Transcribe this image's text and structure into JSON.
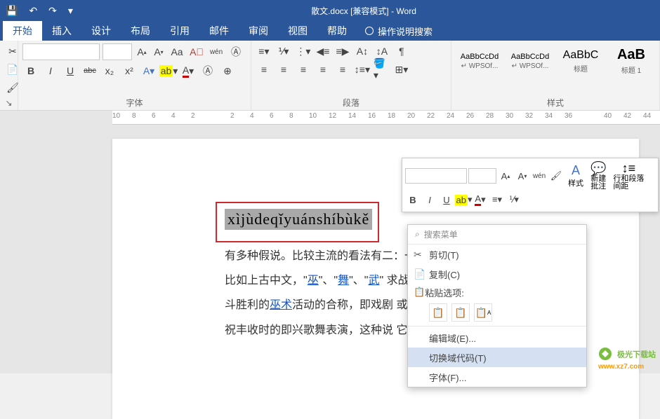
{
  "title": "散文.docx [兼容模式] - Word",
  "tabs": {
    "t0": "开始",
    "t1": "插入",
    "t2": "设计",
    "t3": "布局",
    "t4": "引用",
    "t5": "邮件",
    "t6": "审阅",
    "t7": "视图",
    "t8": "帮助"
  },
  "tellme": "操作说明搜索",
  "font": {
    "bold": "B",
    "italic": "I",
    "underline": "U",
    "strike": "abc",
    "sub": "x₂",
    "sup": "x²",
    "grow": "A",
    "shrink": "A",
    "case": "Aa",
    "clear": "A",
    "wen": "wén",
    "ruby": "A",
    "color": "A",
    "hilite": "ab"
  },
  "group_labels": {
    "font": "字体",
    "para": "段落",
    "style": "样式"
  },
  "styles": [
    {
      "preview": "AaBbCcDd",
      "name": "↵ WPSOf..."
    },
    {
      "preview": "AaBbCcDd",
      "name": "↵ WPSOf..."
    },
    {
      "preview": "AaBbC",
      "name": "标题"
    },
    {
      "preview": "AaB",
      "name": "标题 1"
    }
  ],
  "ruler": [
    "10",
    "8",
    "6",
    "4",
    "2",
    "",
    "2",
    "4",
    "6",
    "8",
    "10",
    "12",
    "14",
    "16",
    "18",
    "20",
    "22",
    "24",
    "26",
    "28",
    "30",
    "32",
    "34",
    "36",
    "",
    "40",
    "42",
    "44"
  ],
  "pinyin_text": "xìjùdeqǐyuánshíbùkě",
  "body_lines": [
    {
      "pre": "有多种假说。比较主流的看法有二：一为原始宗教的巫术仪式，"
    },
    {
      "pre": "比如上古中文，\"",
      "l1": "巫",
      "m1": "\"、\"",
      "l2": "舞",
      "m2": "\"、\"",
      "l3": "武",
      "m3": "\"                                    求战"
    },
    {
      "pre": "斗胜利的",
      "l1": "巫术",
      "m1": "活动的合称，即戏剧                                    或庆"
    },
    {
      "pre": "祝丰收时的即兴歌舞表演，这种说                                    它"
    }
  ],
  "mini": {
    "styles": "样式",
    "newcom": "新建\n批注",
    "spacing": "行和段落\n间距"
  },
  "ctx": {
    "search": "搜索菜单",
    "cut": "剪切(T)",
    "copy": "复制(C)",
    "paste_head": "粘贴选项:",
    "editfield": "编辑域(E)...",
    "togglecode": "切换域代码(T)",
    "font": "字体(F)..."
  },
  "watermark": {
    "name": "极光下载站",
    "url": "www.xz7.com"
  }
}
